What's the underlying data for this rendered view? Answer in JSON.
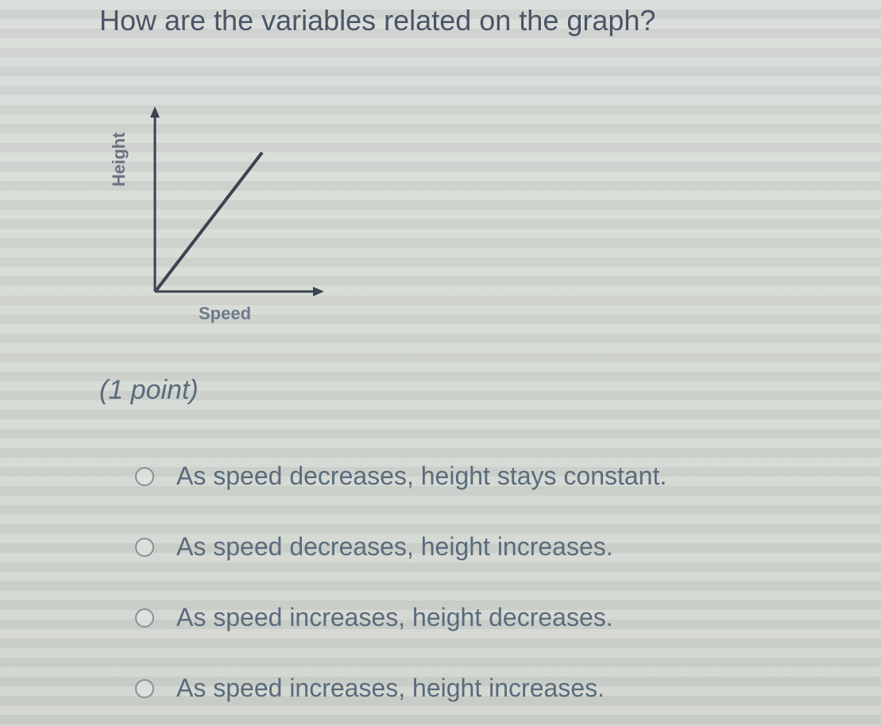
{
  "question": {
    "text": "How are the variables related on the graph?",
    "points_label": "(1 point)"
  },
  "chart_data": {
    "type": "line",
    "title": "",
    "xlabel": "Speed",
    "ylabel": "Height",
    "description": "Positive linear relationship from origin",
    "x": [
      0,
      10
    ],
    "y": [
      0,
      10
    ],
    "xlim": [
      0,
      12
    ],
    "ylim": [
      0,
      12
    ]
  },
  "options": [
    {
      "text": "As speed decreases, height stays constant."
    },
    {
      "text": "As speed decreases, height increases."
    },
    {
      "text": "As speed increases, height decreases."
    },
    {
      "text": "As speed increases, height increases."
    }
  ]
}
